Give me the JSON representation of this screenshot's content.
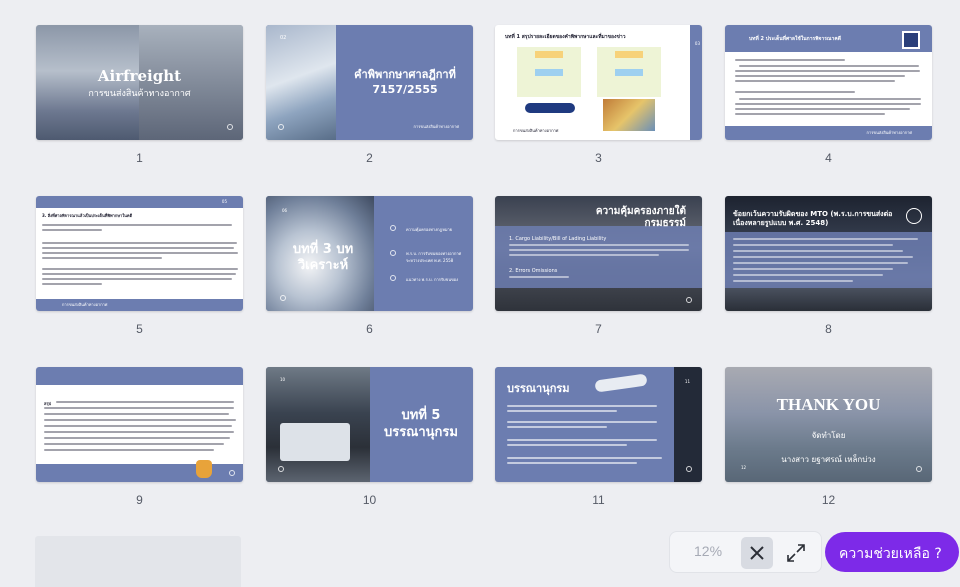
{
  "slides": [
    {
      "number": "1",
      "title": "Airfreight",
      "subtitle": "การขนส่งสินค้าทางอากาศ"
    },
    {
      "number": "2",
      "page_tag": "02",
      "title": "คำพิพากษาศาลฎีกาที่ 7157/2555",
      "footer": "การขนส่งสินค้าทางอากาศ"
    },
    {
      "number": "3",
      "heading": "บทที่ 1   สรุปรายละเอียดของคำพิพากษาและที่มาของข่าว",
      "footer": "การขนส่งสินค้าทางอากาศ",
      "page_tag": "03"
    },
    {
      "number": "4",
      "heading": "บทที่ 2   ประเด็นที่ศาลใช้ในการพิจารณาคดี",
      "footer": "การขนส่งสินค้าทางอากาศ"
    },
    {
      "number": "5",
      "heading": "3. สิ่งที่ศาลพิจารณาแล้วเป็นประเด็นที่พิพากษาในคดี",
      "footer": "การขนส่งสินค้าทางอากาศ",
      "page_tag": "05"
    },
    {
      "number": "6",
      "page_tag": "06",
      "title": "บทที่ 3 บทวิเคราะห์",
      "items": [
        "ความคุ้มครองทางกฎหมาย",
        "พ.ร.บ. การรับขนของทางอากาศระหว่างประเทศ พ.ศ. 2558",
        "แนวทาง พ.ร.บ. การรับขนของ"
      ]
    },
    {
      "number": "7",
      "title": "ความคุ้มครองภายใต้ กรมธรรม์",
      "items": [
        "1. Cargo Liability/Bill of Lading Liability",
        "2. Errors Omissions"
      ]
    },
    {
      "number": "8",
      "title": "ข้อยกเว้นความรับผิดของ MTO (พ.ร.บ.การขนส่งต่อเนื่องหลายรูปแบบ พ.ศ. 2548)"
    },
    {
      "number": "9",
      "lead": "สรุป"
    },
    {
      "number": "10",
      "page_tag": "10",
      "title": "บทที่ 5 บรรณานุกรม"
    },
    {
      "number": "11",
      "title": "บรรณานุกรม",
      "page_tag": "11"
    },
    {
      "number": "12",
      "title": "THANK YOU",
      "subtitle": "จัดทำโดย",
      "author": "นางสาว ยฐาศรณ์ เหล็กบ่วง",
      "page_tag": "12"
    }
  ],
  "controls": {
    "zoom": "12%",
    "help": "ความช่วยเหลือ ?"
  },
  "colors": {
    "accent": "#7d2ae8",
    "slide_blue": "#6c7db0"
  }
}
